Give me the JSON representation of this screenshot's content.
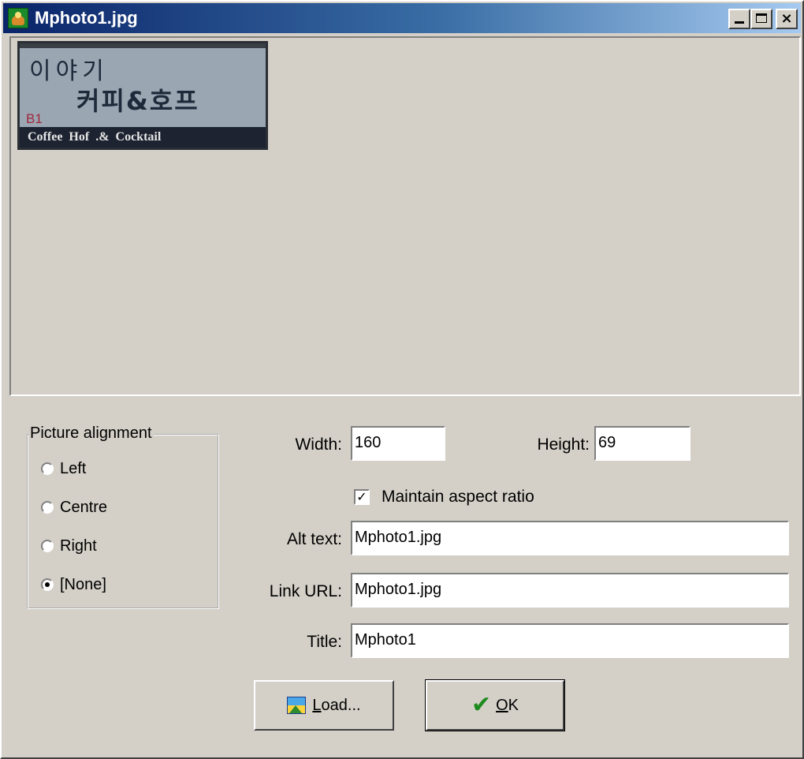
{
  "window": {
    "title": "Mphoto1.jpg",
    "close_glyph": "×"
  },
  "preview": {
    "sign_line1": "이야기",
    "sign_line2": "커피&호프",
    "sign_floor": "B1",
    "sign_band": "Coffee Hof .& Cocktail"
  },
  "alignment": {
    "legend": "Picture alignment",
    "options": [
      {
        "label": "Left",
        "checked": false
      },
      {
        "label": "Centre",
        "checked": false
      },
      {
        "label": "Right",
        "checked": false
      },
      {
        "label": "[None]",
        "checked": true
      }
    ]
  },
  "size": {
    "width_label": "Width:",
    "width_value": "160",
    "height_label": "Height:",
    "height_value": "69"
  },
  "aspect": {
    "label": "Maintain aspect ratio",
    "checked": true,
    "check_glyph": "✓"
  },
  "fields": {
    "alt_label": "Alt text:",
    "alt_value": "Mphoto1.jpg",
    "link_label": "Link URL:",
    "link_value": "Mphoto1.jpg",
    "title_label": "Title:",
    "title_value": "Mphoto1"
  },
  "buttons": {
    "load_mnemonic": "L",
    "load_rest": "oad...",
    "ok_mnemonic": "O",
    "ok_rest": "K",
    "ok_glyph": "✔"
  },
  "icons": {
    "app": "camera-icon",
    "minimize": "minimize-icon",
    "maximize": "maximize-icon",
    "close": "close-icon",
    "load": "picture-icon",
    "ok": "checkmark-icon"
  },
  "colors": {
    "titlebar_start": "#0a246a",
    "titlebar_end": "#a6caf0",
    "face": "#d4d0c8",
    "ok_check": "#1e8a1e"
  }
}
